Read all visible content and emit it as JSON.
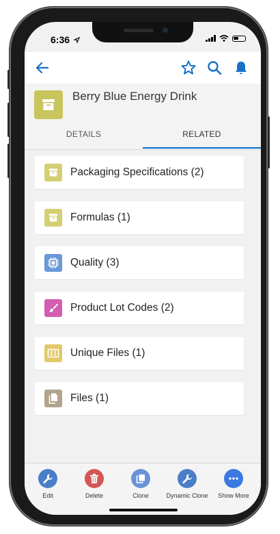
{
  "status_bar": {
    "time": "6:36"
  },
  "record": {
    "title": "Berry Blue Energy Drink",
    "icon": "archive-box-icon",
    "icon_color": "#c8c55c"
  },
  "tabs": [
    {
      "label": "DETAILS",
      "active": false
    },
    {
      "label": "RELATED",
      "active": true
    }
  ],
  "related_lists": [
    {
      "label": "Packaging Specifications (2)",
      "icon": "archive-box-icon",
      "color": "#d3cf72"
    },
    {
      "label": "Formulas (1)",
      "icon": "archive-box-icon",
      "color": "#d3cf72"
    },
    {
      "label": "Quality (3)",
      "icon": "chip-icon",
      "color": "#6a97d8"
    },
    {
      "label": "Product Lot Codes (2)",
      "icon": "brush-icon",
      "color": "#d35db1"
    },
    {
      "label": "Unique Files (1)",
      "icon": "folder-icon",
      "color": "#e2c96a"
    },
    {
      "label": "Files (1)",
      "icon": "document-icon",
      "color": "#b2a48c"
    }
  ],
  "actions": [
    {
      "label": "Edit",
      "icon": "wrench-icon",
      "color": "#4a7ec8"
    },
    {
      "label": "Delete",
      "icon": "trash-icon",
      "color": "#d45656"
    },
    {
      "label": "Clone",
      "icon": "copy-icon",
      "color": "#6a92d8"
    },
    {
      "label": "Dynamic Clone",
      "icon": "wrench-icon",
      "color": "#4a7ec8"
    },
    {
      "label": "Show More",
      "icon": "more-icon",
      "color": "#3b78e0"
    }
  ],
  "colors": {
    "accent": "#1672c6",
    "tab_underline": "#0070d2"
  }
}
